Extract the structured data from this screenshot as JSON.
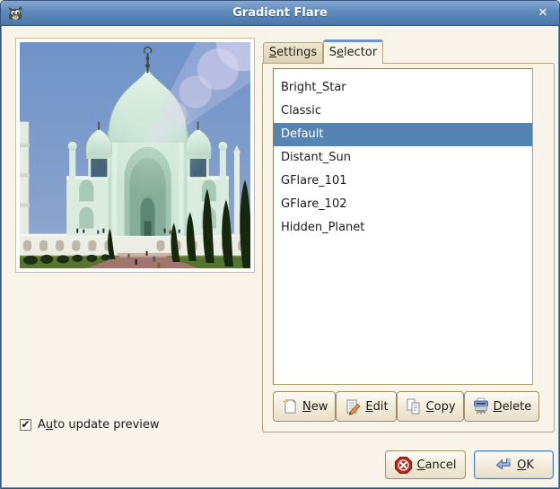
{
  "window": {
    "title": "Gradient Flare"
  },
  "icons": {
    "close": "✕",
    "check": "✔"
  },
  "tabs": {
    "settings": {
      "pre": "",
      "mn": "S",
      "post": "ettings"
    },
    "selector": {
      "pre": "S",
      "mn": "e",
      "post": "lector"
    }
  },
  "flare_list": {
    "items": [
      "Bright_Star",
      "Classic",
      "Default",
      "Distant_Sun",
      "GFlare_101",
      "GFlare_102",
      "Hidden_Planet"
    ],
    "selected": "Default",
    "selected_index": 2
  },
  "list_actions": {
    "new": {
      "pre": "",
      "mn": "N",
      "post": "ew"
    },
    "edit": {
      "pre": "",
      "mn": "E",
      "post": "dit"
    },
    "copy": {
      "pre": "",
      "mn": "C",
      "post": "opy"
    },
    "delete": {
      "pre": "",
      "mn": "D",
      "post": "elete"
    }
  },
  "auto_update": {
    "pre": "A",
    "mn": "u",
    "post": "to update preview",
    "checked": true
  },
  "dialog": {
    "cancel": {
      "pre": "",
      "mn": "C",
      "post": "ancel"
    },
    "ok": {
      "pre": "",
      "mn": "O",
      "post": "K"
    }
  },
  "colors": {
    "selection_bg": "#5584b2",
    "titlebar": "#5d89bb",
    "tab_accent": "#6d94c4",
    "window_bg": "#f8f4e9"
  }
}
